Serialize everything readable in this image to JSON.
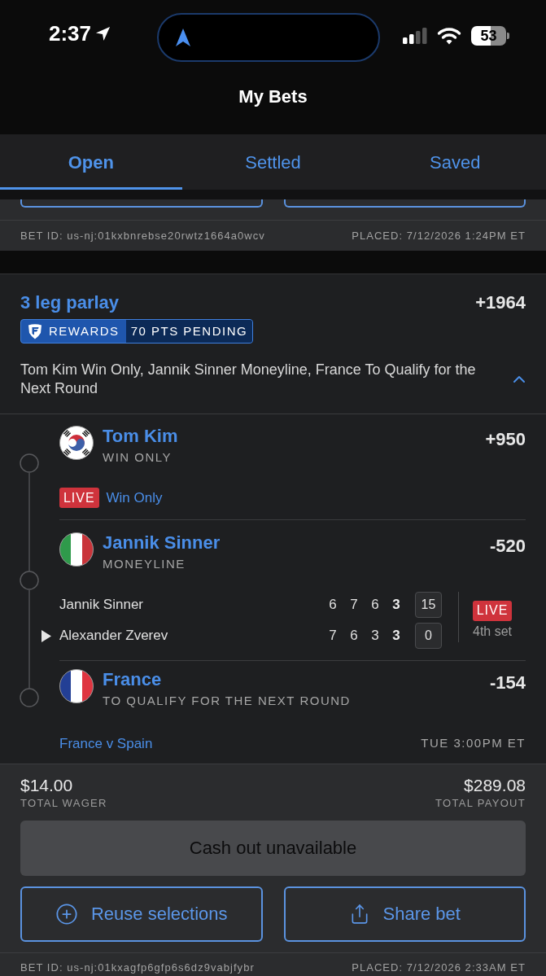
{
  "status_bar": {
    "time": "2:37",
    "battery": "53"
  },
  "header": {
    "title": "My Bets"
  },
  "tabs": [
    {
      "label": "Open",
      "selected": true
    },
    {
      "label": "Settled",
      "selected": false
    },
    {
      "label": "Saved",
      "selected": false
    }
  ],
  "previous_bet": {
    "bet_id": "BET ID: us-nj:01kxbnrebse20rwtz1664a0wcv",
    "placed": "PLACED: 7/12/2026 1:24PM ET"
  },
  "bet": {
    "title": "3 leg parlay",
    "odds": "+1964",
    "rewards": {
      "label": "REWARDS",
      "points": "70 PTS PENDING"
    },
    "summary": "Tom Kim Win Only, Jannik Sinner Moneyline, France To Qualify for the Next Round",
    "expanded": true,
    "legs": [
      {
        "kind": "live",
        "name": "Tom Kim",
        "market": "WIN ONLY",
        "odds": "+950",
        "badge": "LIVE",
        "link": "Win Only"
      },
      {
        "kind": "scoreboard",
        "name": "Jannik Sinner",
        "market": "MONEYLINE",
        "odds": "-520",
        "players": [
          {
            "name": "Jannik Sinner",
            "serving": false,
            "sets": [
              "6",
              "7",
              "6",
              "3"
            ],
            "game": "15"
          },
          {
            "name": "Alexander Zverev",
            "serving": true,
            "sets": [
              "7",
              "6",
              "3",
              "3"
            ],
            "game": "0"
          }
        ],
        "badge": "LIVE",
        "period": "4th set"
      },
      {
        "kind": "event",
        "name": "France",
        "market": "TO QUALIFY FOR THE NEXT ROUND",
        "odds": "-154",
        "event": "France v Spain",
        "time": "TUE 3:00PM ET"
      }
    ],
    "total_wager": {
      "amount": "$14.00",
      "label": "TOTAL WAGER"
    },
    "total_payout": {
      "amount": "$289.08",
      "label": "TOTAL PAYOUT"
    },
    "cash_out": {
      "label": "Cash out unavailable",
      "disabled": true
    },
    "actions": [
      {
        "kind": "reuse",
        "label": "Reuse selections"
      },
      {
        "kind": "share",
        "label": "Share bet"
      }
    ],
    "bet_id": "BET ID: us-nj:01kxagfp6gfp6s6dz9vabjfybr",
    "placed": "PLACED: 7/12/2026 2:33AM ET"
  }
}
